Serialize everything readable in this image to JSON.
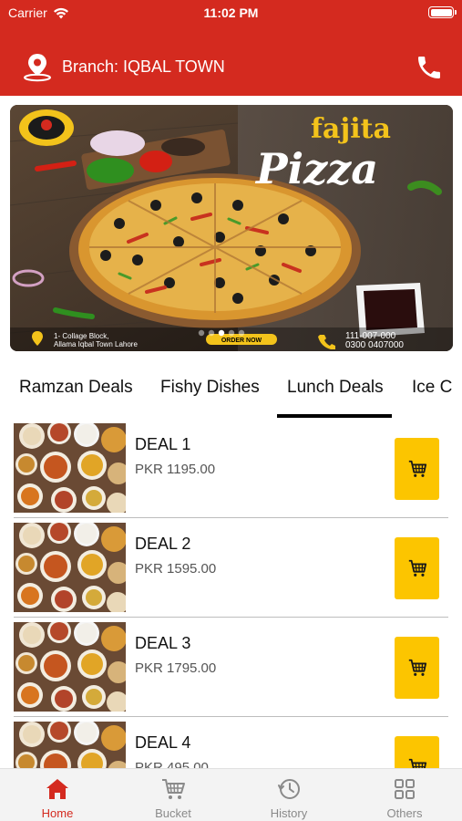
{
  "status_bar": {
    "carrier": "Carrier",
    "time": "11:02 PM"
  },
  "header": {
    "branch_label": "Branch: IQBAL TOWN",
    "location_icon": "location-pin-icon",
    "phone_icon": "phone-icon"
  },
  "banner": {
    "title_line1": "fajita",
    "title_line2": "Pizza",
    "address_line1": "1- Collage Block,",
    "address_line2": "Allama Iqbal Town Lahore",
    "order_button": "ORDER NOW",
    "phone_line1": "111-007-000",
    "phone_line2": "0300 0407000",
    "page_count": 5,
    "active_page": 3
  },
  "category_tabs": [
    {
      "label": "Ramzan Deals"
    },
    {
      "label": "Fishy Dishes"
    },
    {
      "label": "Lunch Deals",
      "active": true
    },
    {
      "label": "Ice C"
    }
  ],
  "deals": [
    {
      "name": "DEAL 1",
      "price": "PKR 1195.00"
    },
    {
      "name": "DEAL 2",
      "price": "PKR 1595.00"
    },
    {
      "name": "DEAL 3",
      "price": "PKR 1795.00"
    },
    {
      "name": "DEAL 4",
      "price": "PKR 495.00"
    }
  ],
  "tab_bar": [
    {
      "label": "Home",
      "icon": "home-icon",
      "active": true
    },
    {
      "label": "Bucket",
      "icon": "cart-icon"
    },
    {
      "label": "History",
      "icon": "clock-icon"
    },
    {
      "label": "Others",
      "icon": "grid-icon"
    }
  ],
  "colors": {
    "brand_red": "#d42a1f",
    "cart_yellow": "#fcc500",
    "inactive_gray": "#8a8a8a"
  }
}
